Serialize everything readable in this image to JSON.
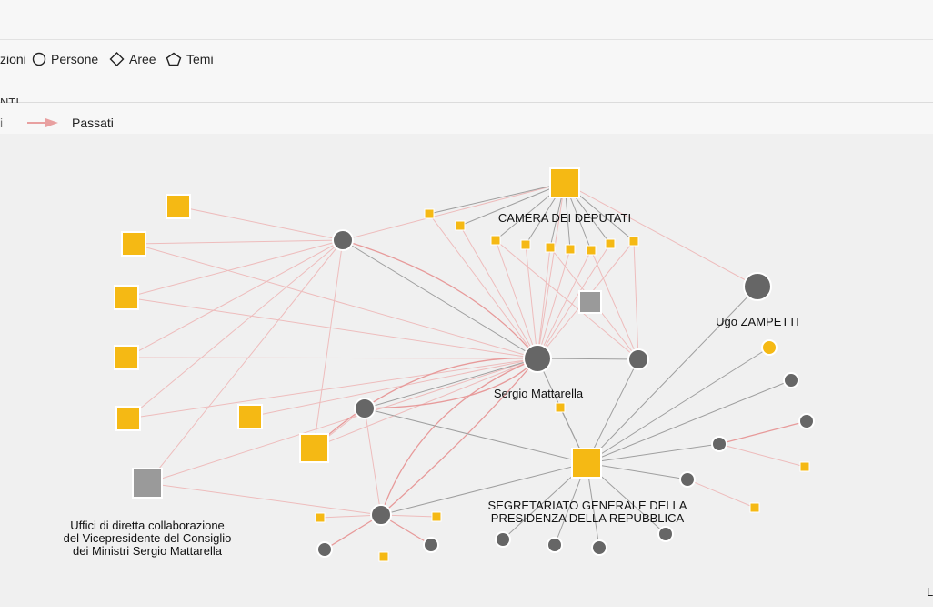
{
  "legend": {
    "tipologie": [
      {
        "label": "zioni",
        "icon": "square-icon"
      },
      {
        "label": "Persone",
        "icon": "circle-icon"
      },
      {
        "label": "Aree",
        "icon": "diamond-icon"
      },
      {
        "label": "Temi",
        "icon": "pentagon-icon"
      }
    ],
    "rapporti_title": "NTI",
    "rapporti": [
      {
        "label": "i"
      },
      {
        "label": "Passati",
        "color": "#e8a0a0"
      }
    ]
  },
  "colors": {
    "organization": "#f5b914",
    "person": "#666666",
    "area": "#9a9a9a",
    "current_link": "#9a9a9a",
    "past_link": "#e8a0a0"
  },
  "graph": {
    "labels": {
      "camera": "CAMERA DEI DEPUTATI",
      "zampetti": "Ugo ZAMPETTI",
      "mattarella": "Sergio Mattarella",
      "segretariato_1": "SEGRETARIATO GENERALE DELLA",
      "segretariato_2": "PRESIDENZA DELLA REPUBBLICA",
      "uffici_1": "Uffici di diretta collaborazione",
      "uffici_2": "del Vicepresidente del Consiglio",
      "uffici_3": "dei Ministri Sergio Mattarella"
    }
  },
  "corner_label": "L"
}
